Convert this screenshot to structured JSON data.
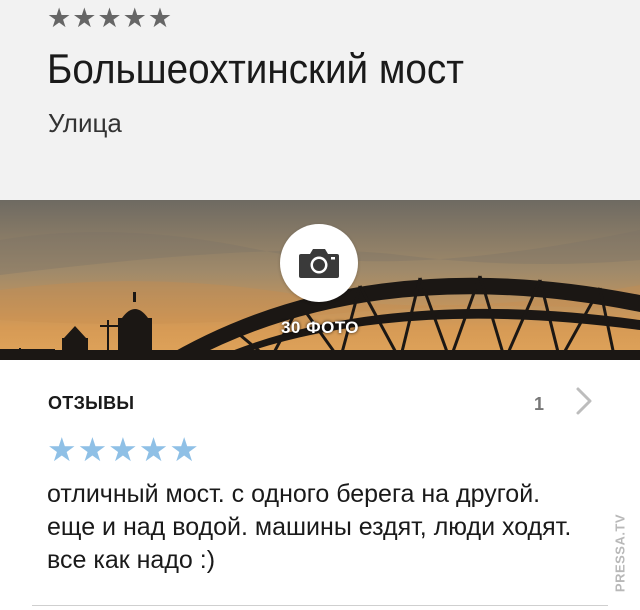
{
  "place": {
    "rating_stars": "★★★★★",
    "title": "Большеохтинский мост",
    "category": "Улица"
  },
  "photos": {
    "count_label": "30 ФОТО",
    "camera_icon": "camera-icon"
  },
  "reviews": {
    "title": "ОТЗЫВЫ",
    "count": "1",
    "item": {
      "stars": "★★★★★",
      "rating": 5,
      "text": "отличный мост. с одного берега на другой. еще и над водой. машины ездят, люди ходят. все как надо :)"
    }
  },
  "watermark": "PRESSA.TV",
  "colors": {
    "header_bg": "#f2f2f2",
    "star_gray": "#666666",
    "star_blue": "#8fc0e6"
  }
}
